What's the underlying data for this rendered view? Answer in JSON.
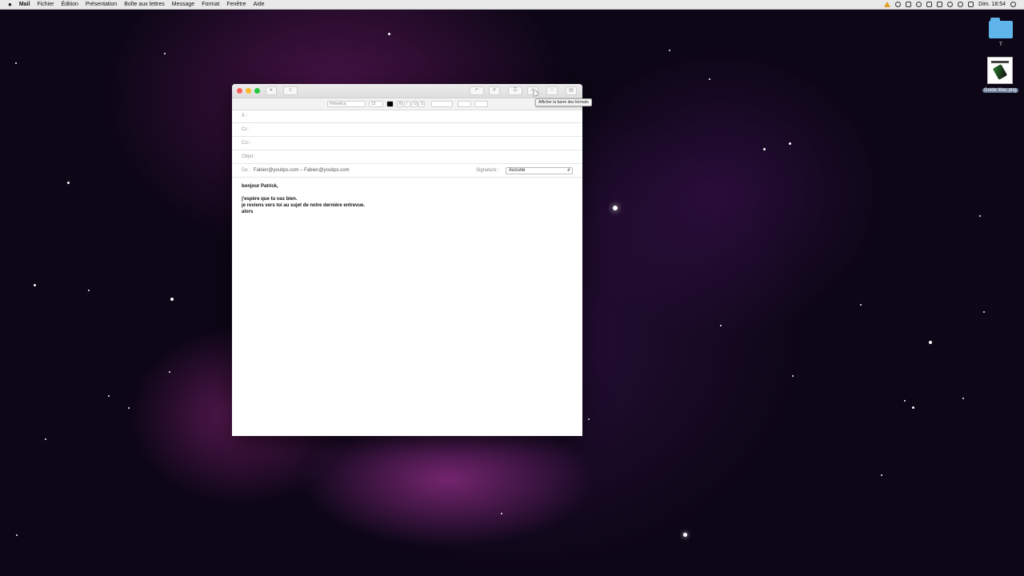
{
  "menubar": {
    "app_name": "Mail",
    "items": [
      "Fichier",
      "Édition",
      "Présentation",
      "Boîte aux lettres",
      "Message",
      "Format",
      "Fenêtre",
      "Aide"
    ],
    "clock": "Dim. 18:54",
    "status_icons": [
      "warning-icon",
      "record-icon",
      "volume-icon",
      "globe-icon",
      "display-icon",
      "dropbox-icon",
      "airdrop-icon",
      "wifi-icon",
      "battery-icon",
      "search-icon"
    ]
  },
  "desktop": {
    "folder_label": "T",
    "file_label": "Guide Mac.png"
  },
  "compose": {
    "format_bar": {
      "font": "Helvetica",
      "size": "12",
      "bold": "B",
      "italic": "I",
      "underline": "U",
      "strike": "S"
    },
    "to_label": "À :",
    "cc_label": "Cc :",
    "bcc_label": "Cci :",
    "subject_label": "Objet :",
    "from_label": "De :",
    "from_value": "Fabien@youtips.com – Fabien@youtips.com",
    "signature_label": "Signature :",
    "signature_value": "Aucune",
    "body_lines": [
      "bonjour Patrick,",
      "",
      "j'espère que tu vas bien.",
      "je reviens vers toi au sujet de notre dernière entrevue.",
      "alors"
    ]
  },
  "tooltip": "Afficher la barre des formats"
}
